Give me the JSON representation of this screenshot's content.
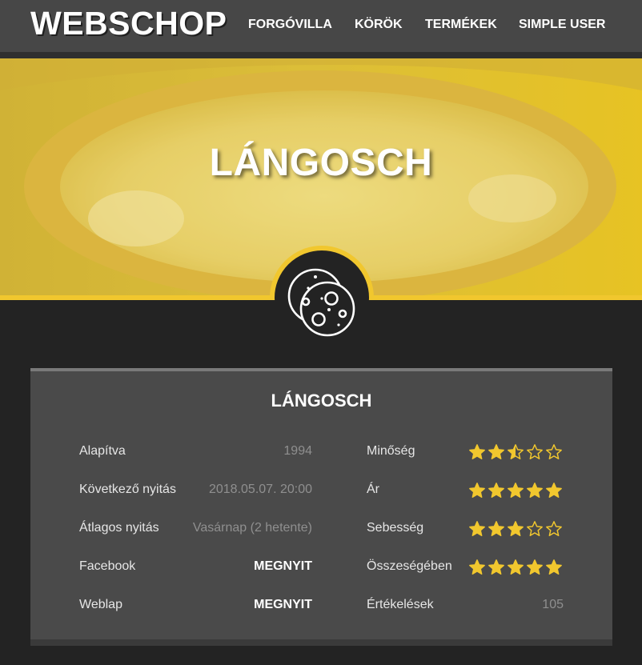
{
  "header": {
    "logo": "WEBSCHOP",
    "nav": [
      "FORGÓVILLA",
      "KÖRÖK",
      "TERMÉKEK",
      "SIMPLE USER"
    ]
  },
  "hero": {
    "title": "LÁNGOSCH",
    "badge_icon": "cookies-icon"
  },
  "card": {
    "title": "LÁNGOSCH",
    "left": [
      {
        "label": "Alapítva",
        "value": "1994"
      },
      {
        "label": "Következő nyitás",
        "value": "2018.05.07. 20:00"
      },
      {
        "label": "Átlagos nyitás",
        "value": "Vasárnap (2 hetente)"
      },
      {
        "label": "Facebook",
        "value": "MEGNYIT"
      },
      {
        "label": "Weblap",
        "value": "MEGNYIT"
      }
    ],
    "right": [
      {
        "label": "Minőség",
        "rating": 2.5
      },
      {
        "label": "Ár",
        "rating": 5
      },
      {
        "label": "Sebesség",
        "rating": 3
      },
      {
        "label": "Összeségében",
        "rating": 5
      },
      {
        "label": "Értékelések",
        "value": "105"
      }
    ]
  },
  "colors": {
    "accent": "#f1c72e",
    "background": "#232323",
    "card": "#4a4a4a",
    "header": "#474747"
  }
}
